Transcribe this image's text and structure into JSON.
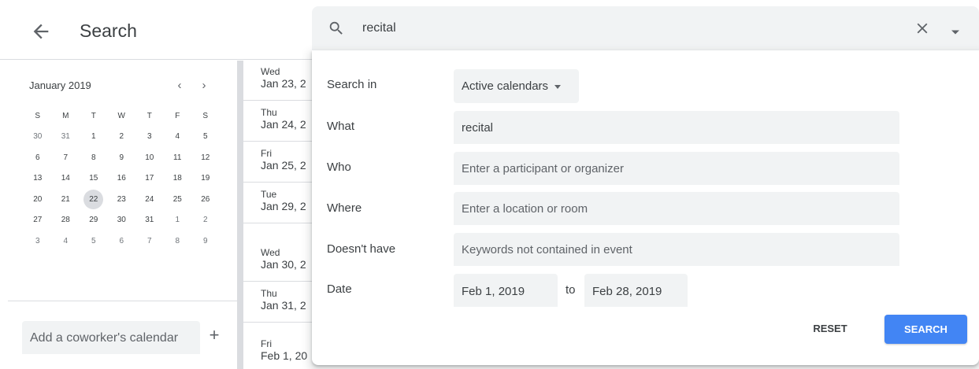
{
  "header": {
    "title": "Search"
  },
  "mini_calendar": {
    "month_label": "January 2019",
    "weekdays": [
      "S",
      "M",
      "T",
      "W",
      "T",
      "F",
      "S"
    ],
    "weeks": [
      [
        "30",
        "31",
        "1",
        "2",
        "3",
        "4",
        "5"
      ],
      [
        "6",
        "7",
        "8",
        "9",
        "10",
        "11",
        "12"
      ],
      [
        "13",
        "14",
        "15",
        "16",
        "17",
        "18",
        "19"
      ],
      [
        "20",
        "21",
        "22",
        "23",
        "24",
        "25",
        "26"
      ],
      [
        "27",
        "28",
        "29",
        "30",
        "31",
        "1",
        "2"
      ],
      [
        "3",
        "4",
        "5",
        "6",
        "7",
        "8",
        "9"
      ]
    ],
    "today": "22"
  },
  "sidebar": {
    "coworker_placeholder": "Add a coworker's calendar"
  },
  "results": [
    {
      "dow": "Wed",
      "date": "Jan 23, 2"
    },
    {
      "dow": "Thu",
      "date": "Jan 24, 2"
    },
    {
      "dow": "Fri",
      "date": "Jan 25, 2"
    },
    {
      "dow": "Tue",
      "date": "Jan 29, 2"
    },
    {
      "dow": "Wed",
      "date": "Jan 30, 2"
    },
    {
      "dow": "Thu",
      "date": "Jan 31, 2"
    },
    {
      "dow": "Fri",
      "date": "Feb 1, 20"
    }
  ],
  "search": {
    "query": "recital",
    "search_in_label": "Search in",
    "search_in_value": "Active calendars",
    "what_label": "What",
    "what_value": "recital",
    "who_label": "Who",
    "who_placeholder": "Enter a participant or organizer",
    "where_label": "Where",
    "where_placeholder": "Enter a location or room",
    "doesnt_have_label": "Doesn't have",
    "doesnt_have_placeholder": "Keywords not contained in event",
    "date_label": "Date",
    "date_from": "Feb 1, 2019",
    "date_to_word": "to",
    "date_to": "Feb 28, 2019",
    "reset_label": "RESET",
    "search_label": "SEARCH"
  },
  "colors": {
    "accent": "#4285f4",
    "field_bg": "#f1f3f4",
    "divider": "#dadce0"
  }
}
